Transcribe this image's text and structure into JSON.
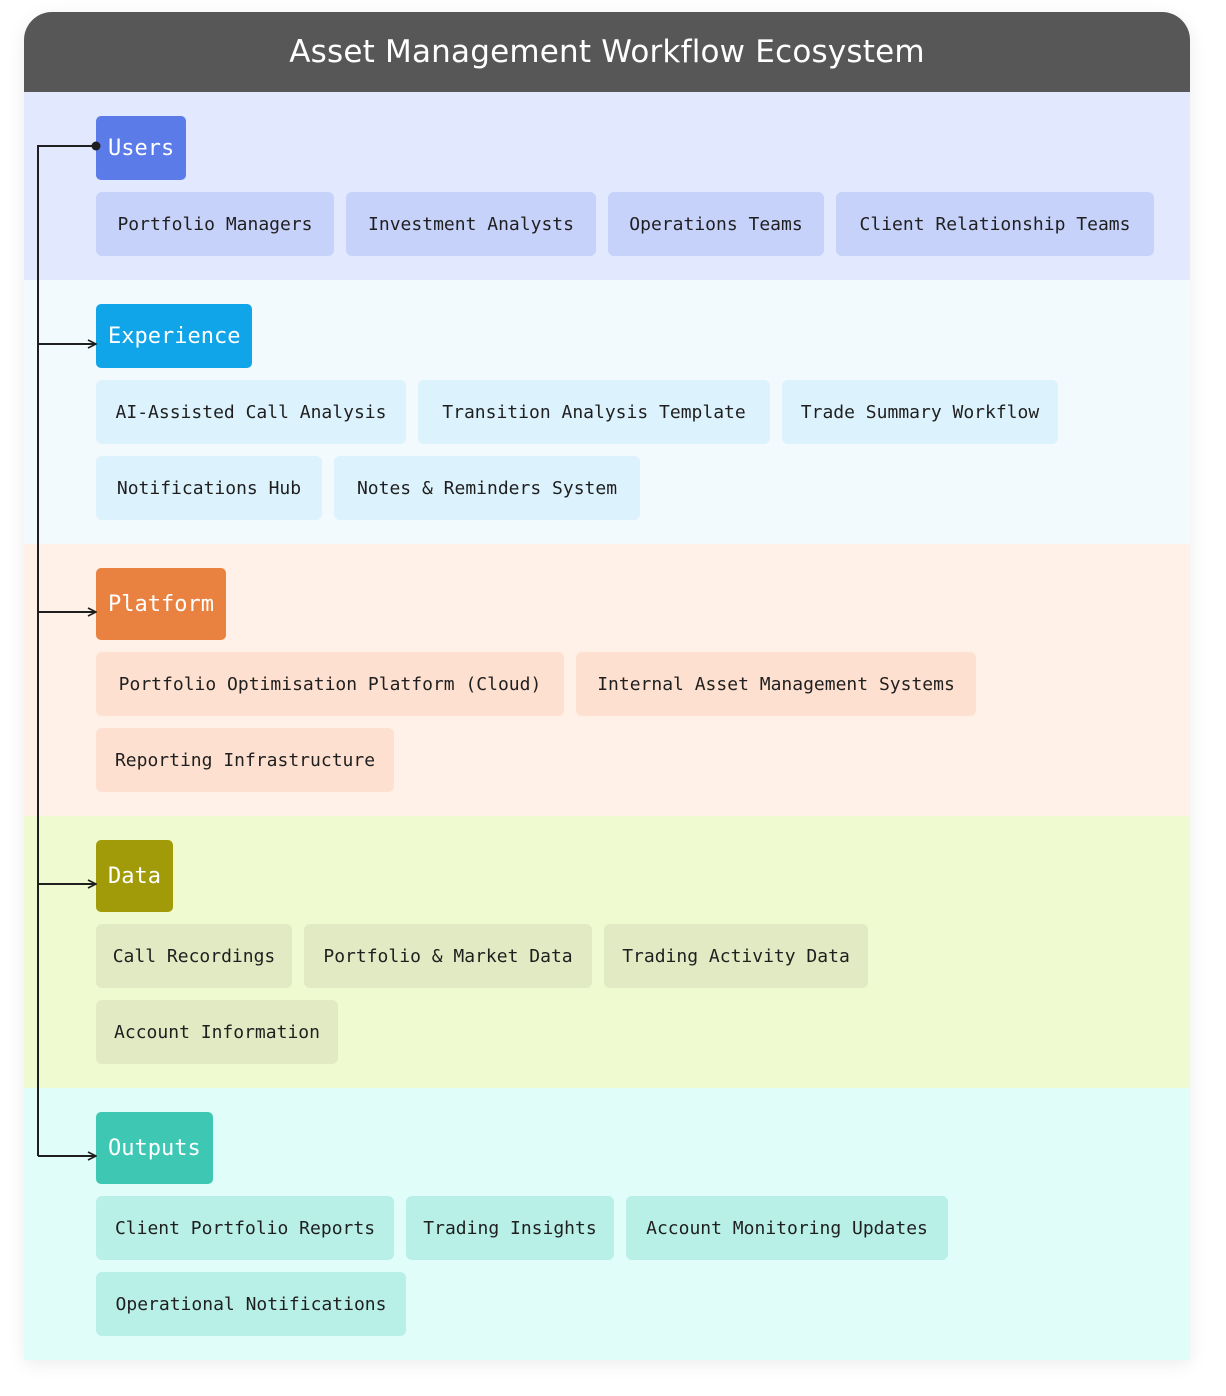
{
  "title": "Asset Management Workflow Ecosystem",
  "colors": {
    "title_bar": "#575757",
    "users": {
      "band": "#e2e8fd",
      "head": "#5b7be9",
      "chip": "#c7d2fb"
    },
    "experience": {
      "band": "#f2fafe",
      "head": "#10a4e9",
      "chip": "#dcf2fd"
    },
    "platform": {
      "band": "#fff0e8",
      "head": "#e98241",
      "chip": "#fde0d0"
    },
    "data": {
      "band": "#f0fad0",
      "head": "#a19b09",
      "chip": "#e1eac2"
    },
    "outputs": {
      "band": "#e1fdfa",
      "head": "#3ec8b3",
      "chip": "#b8f0e7"
    },
    "connector": "#1f1f1f"
  },
  "sections": {
    "users": {
      "label": "Users",
      "items": [
        "Portfolio Managers",
        "Investment Analysts",
        "Operations Teams",
        "Client Relationship Teams"
      ]
    },
    "experience": {
      "label": "Experience",
      "items": [
        "AI-Assisted Call Analysis",
        "Transition Analysis Template",
        "Trade Summary Workflow",
        "Notifications Hub",
        "Notes & Reminders System"
      ]
    },
    "platform": {
      "label": "Platform",
      "items": [
        "Portfolio Optimisation Platform (Cloud)",
        "Internal Asset Management Systems",
        "Reporting Infrastructure"
      ]
    },
    "data": {
      "label": "Data",
      "items": [
        "Call Recordings",
        "Portfolio & Market Data",
        "Trading Activity Data",
        "Account Information"
      ]
    },
    "outputs": {
      "label": "Outputs",
      "items": [
        "Client Portfolio Reports",
        "Trading Insights",
        "Account Monitoring Updates",
        "Operational Notifications"
      ]
    }
  }
}
